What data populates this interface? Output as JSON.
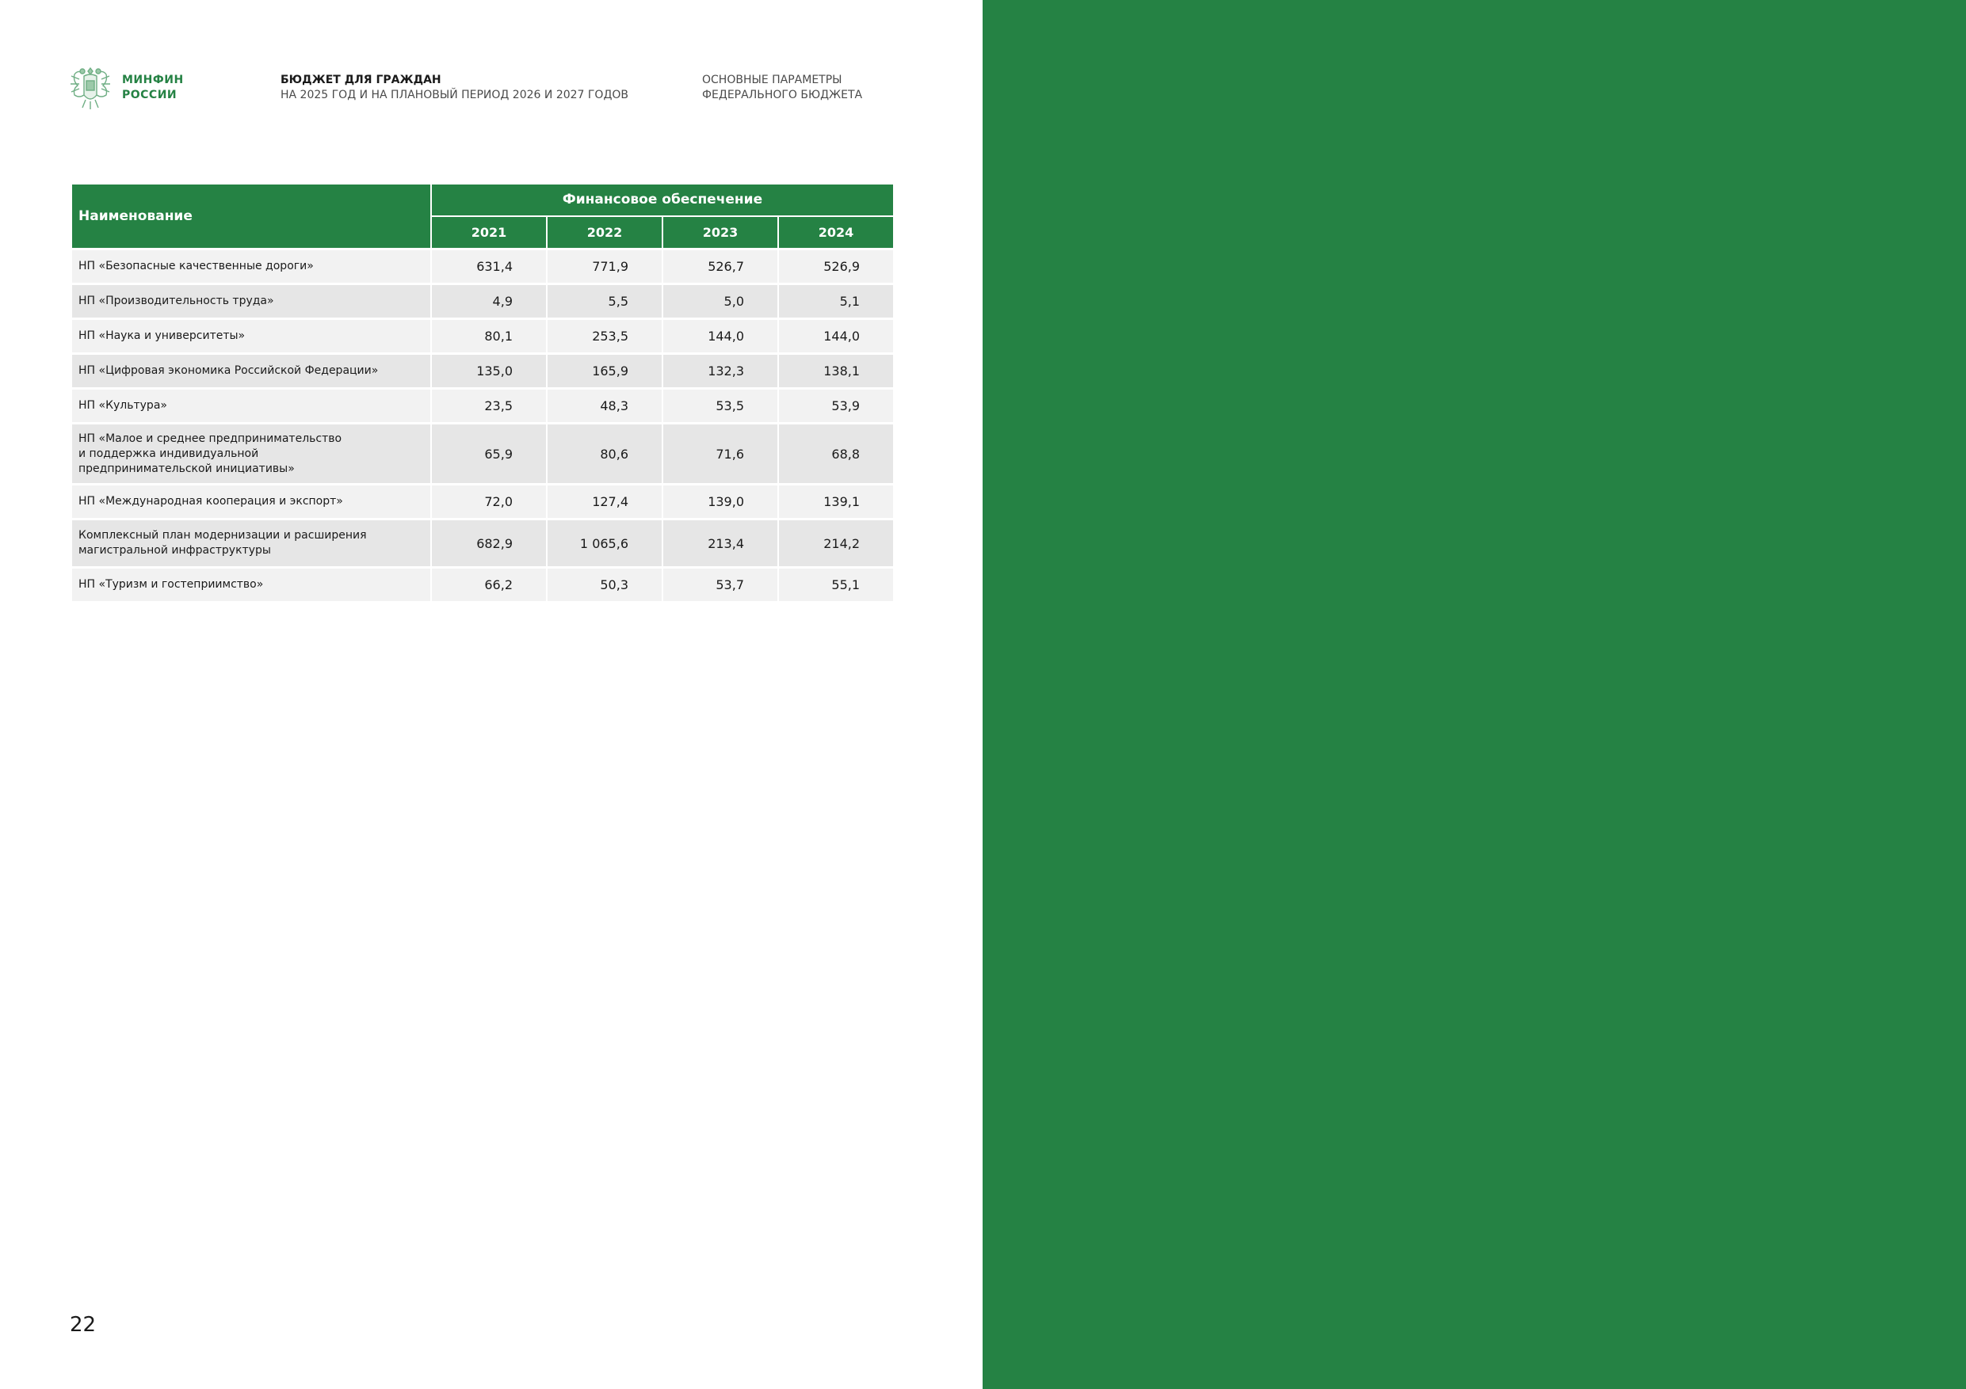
{
  "colors": {
    "brand_green": "#258244",
    "row_light": "#f2f2f2",
    "row_dark": "#e6e6e6"
  },
  "header": {
    "logo_icon": "coat-of-arms-icon",
    "logo_line1": "МИНФИН",
    "logo_line2": "РОССИИ",
    "title": "БЮДЖЕТ ДЛЯ ГРАЖДАН",
    "subtitle": "НА 2025 ГОД И НА ПЛАНОВЫЙ ПЕРИОД 2026 И 2027 ГОДОВ",
    "section_line1": "ОСНОВНЫЕ ПАРАМЕТРЫ",
    "section_line2": "ФЕДЕРАЛЬНОГО БЮДЖЕТА"
  },
  "table": {
    "name_header": "Наименование",
    "group_header": "Финансовое обеспечение",
    "years": [
      "2021",
      "2022",
      "2023",
      "2024"
    ],
    "rows": [
      {
        "name": "НП «Безопасные качественные дороги»",
        "values": [
          "631,4",
          "771,9",
          "526,7",
          "526,9"
        ]
      },
      {
        "name": "НП «Производительность труда»",
        "values": [
          "4,9",
          "5,5",
          "5,0",
          "5,1"
        ]
      },
      {
        "name": "НП «Наука и университеты»",
        "values": [
          "80,1",
          "253,5",
          "144,0",
          "144,0"
        ]
      },
      {
        "name": "НП «Цифровая экономика Российской Федерации»",
        "values": [
          "135,0",
          "165,9",
          "132,3",
          "138,1"
        ]
      },
      {
        "name": "НП «Культура»",
        "values": [
          "23,5",
          "48,3",
          "53,5",
          "53,9"
        ]
      },
      {
        "name_lines": [
          "НП «Малое и среднее предпринимательство",
          "и поддержка индивидуальной",
          "предпринимательской инициативы»"
        ],
        "values": [
          "65,9",
          "80,6",
          "71,6",
          "68,8"
        ]
      },
      {
        "name": "НП «Международная кооперация и экспорт»",
        "values": [
          "72,0",
          "127,4",
          "139,0",
          "139,1"
        ]
      },
      {
        "name_lines": [
          "Комплексный план модернизации и расширения",
          "магистральной инфраструктуры"
        ],
        "values": [
          "682,9",
          "1 065,6",
          "213,4",
          "214,2"
        ]
      },
      {
        "name": "НП «Туризм и гостеприимство»",
        "values": [
          "66,2",
          "50,3",
          "53,7",
          "55,1"
        ]
      }
    ]
  },
  "page_number": "22"
}
